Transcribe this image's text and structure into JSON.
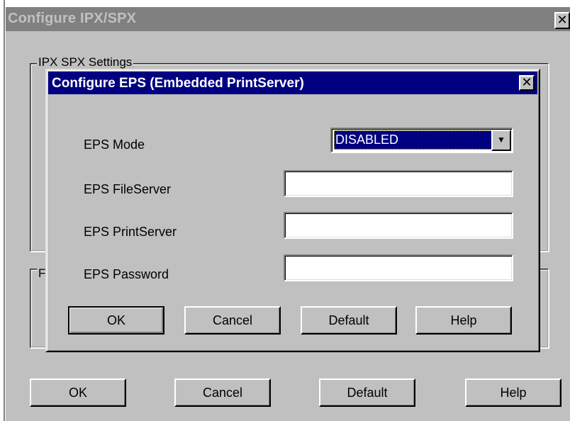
{
  "outer_dialog": {
    "title": "Configure IPX/SPX",
    "close_glyph": "✕",
    "group1_label": "IPX  SPX Settings",
    "group2_label": "F",
    "buttons": {
      "ok": "OK",
      "cancel": "Cancel",
      "default": "Default",
      "help": "Help"
    }
  },
  "eps_dialog": {
    "title": "Configure EPS (Embedded PrintServer)",
    "close_glyph": "✕",
    "fields": {
      "mode": {
        "label": "EPS Mode",
        "value": "DISABLED"
      },
      "fileserver": {
        "label": "EPS FileServer",
        "value": ""
      },
      "printserver": {
        "label": "EPS PrintServer",
        "value": ""
      },
      "password": {
        "label": "EPS Password",
        "value": ""
      }
    },
    "dropdown_arrow": "▼",
    "buttons": {
      "ok": "OK",
      "cancel": "Cancel",
      "default": "Default",
      "help": "Help"
    }
  },
  "colors": {
    "dialog_face": "#c0c0c0",
    "active_title": "#000080",
    "inactive_title": "#808080"
  }
}
